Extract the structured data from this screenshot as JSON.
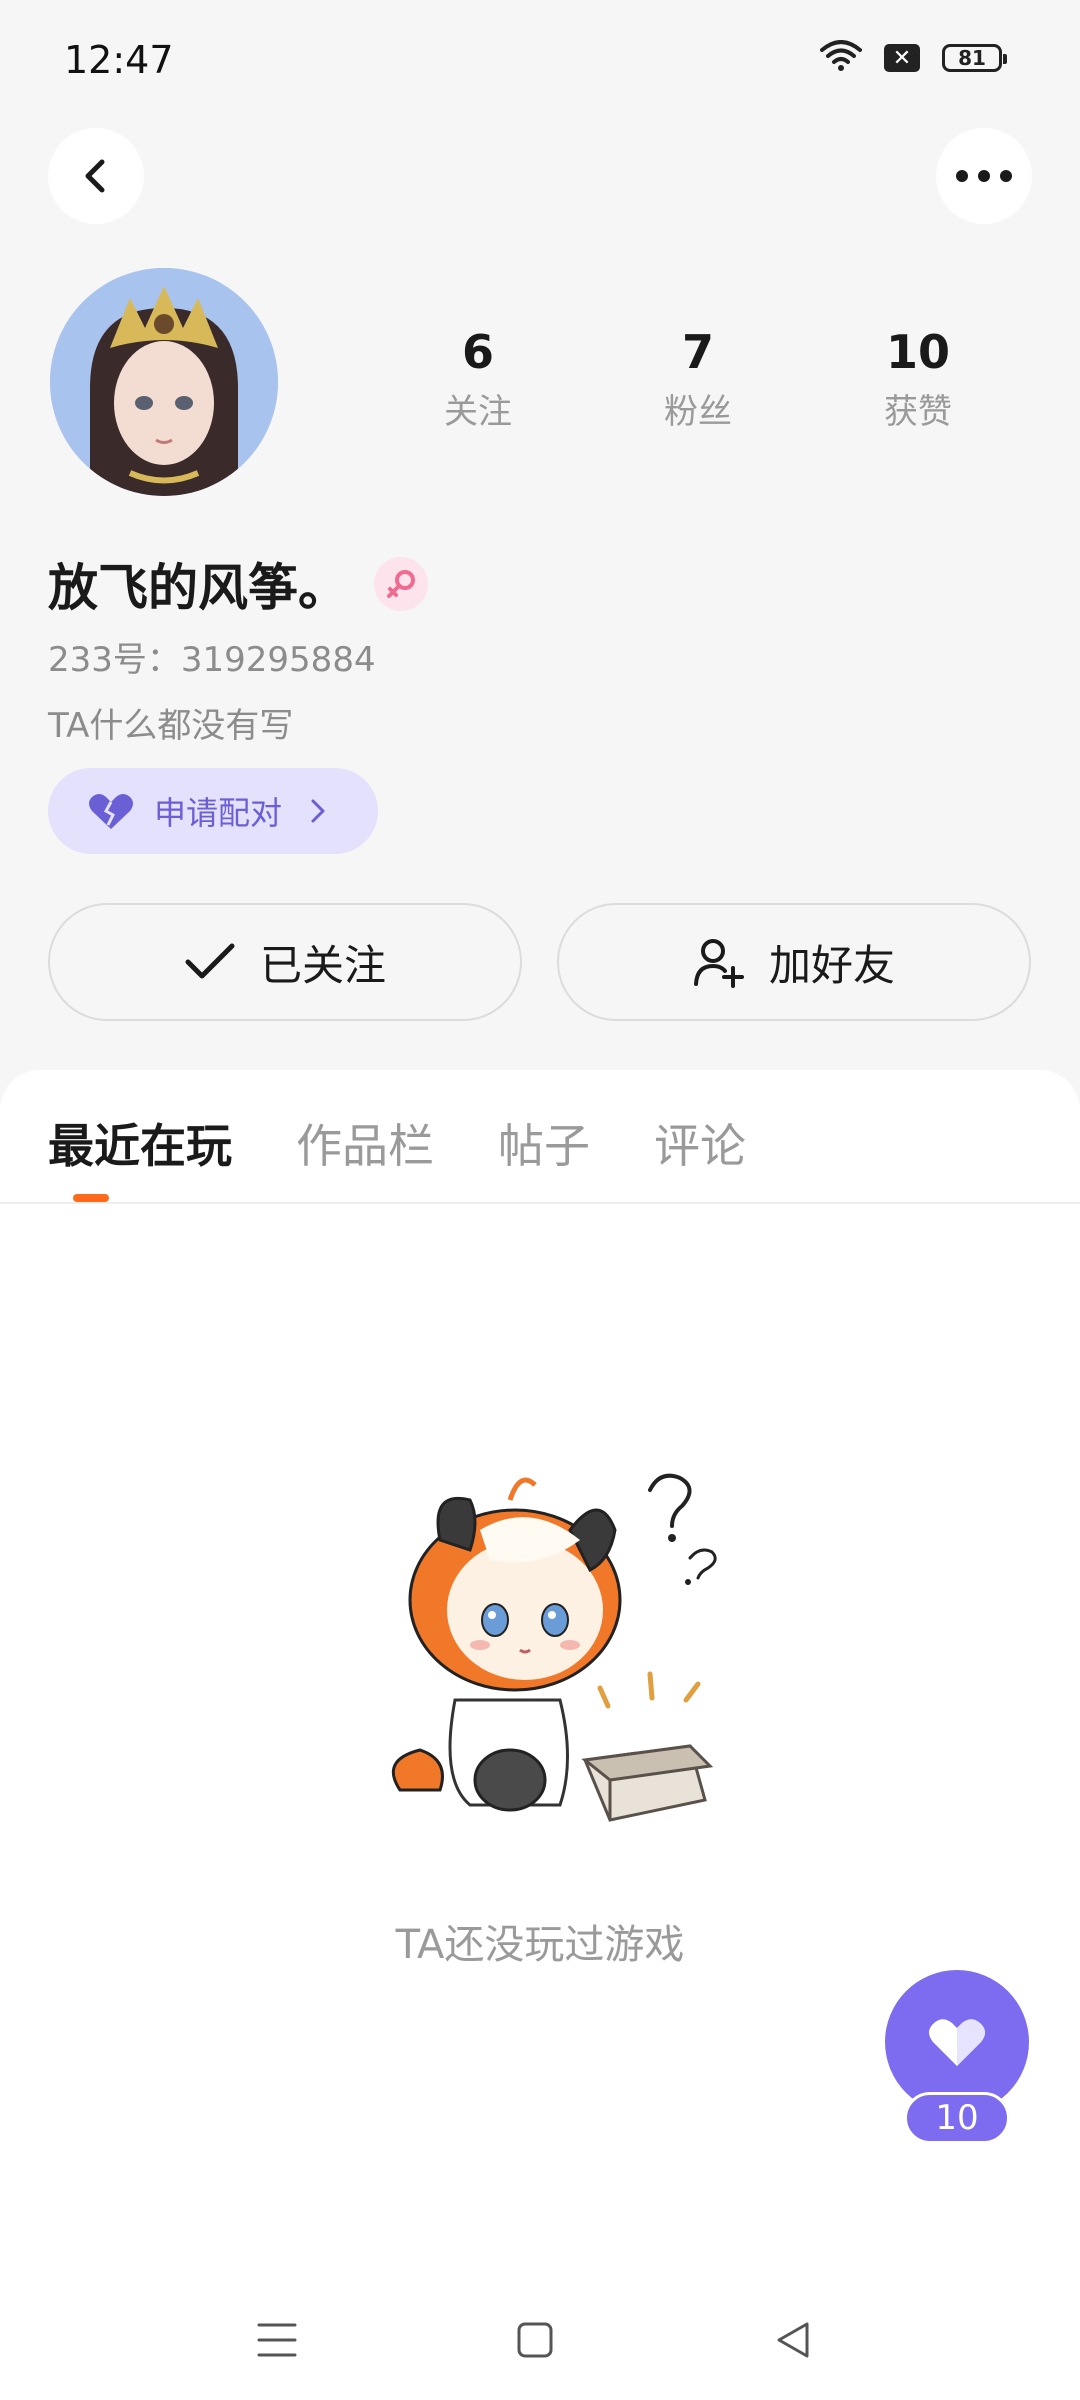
{
  "status_bar": {
    "time": "12:47",
    "battery": "81",
    "icons": [
      "wifi-icon",
      "sim-off-icon",
      "battery-icon"
    ]
  },
  "header": {
    "back_icon": "chevron-left-icon",
    "more_icon": "more-dots-icon"
  },
  "profile": {
    "name": "放飞的风筝。",
    "gender_icon": "female-icon",
    "uid": "233号：319295884",
    "bio": "TA什么都没有写",
    "stats": [
      {
        "value": "6",
        "label": "关注"
      },
      {
        "value": "7",
        "label": "粉丝"
      },
      {
        "value": "10",
        "label": "获赞"
      }
    ],
    "pair_button": "申请配对",
    "follow_button": "已关注",
    "add_friend_button": "加好友"
  },
  "tabs": [
    {
      "label": "最近在玩",
      "active": true
    },
    {
      "label": "作品栏",
      "active": false
    },
    {
      "label": "帖子",
      "active": false
    },
    {
      "label": "评论",
      "active": false
    }
  ],
  "empty_state": {
    "text": "TA还没玩过游戏"
  },
  "like_fab": {
    "count": "10"
  },
  "colors": {
    "accent_purple": "#7d6cf0",
    "pair_bg": "#e3e1fb",
    "tab_indicator": "#ff6a1a",
    "page_bg": "#f6f6f7"
  }
}
